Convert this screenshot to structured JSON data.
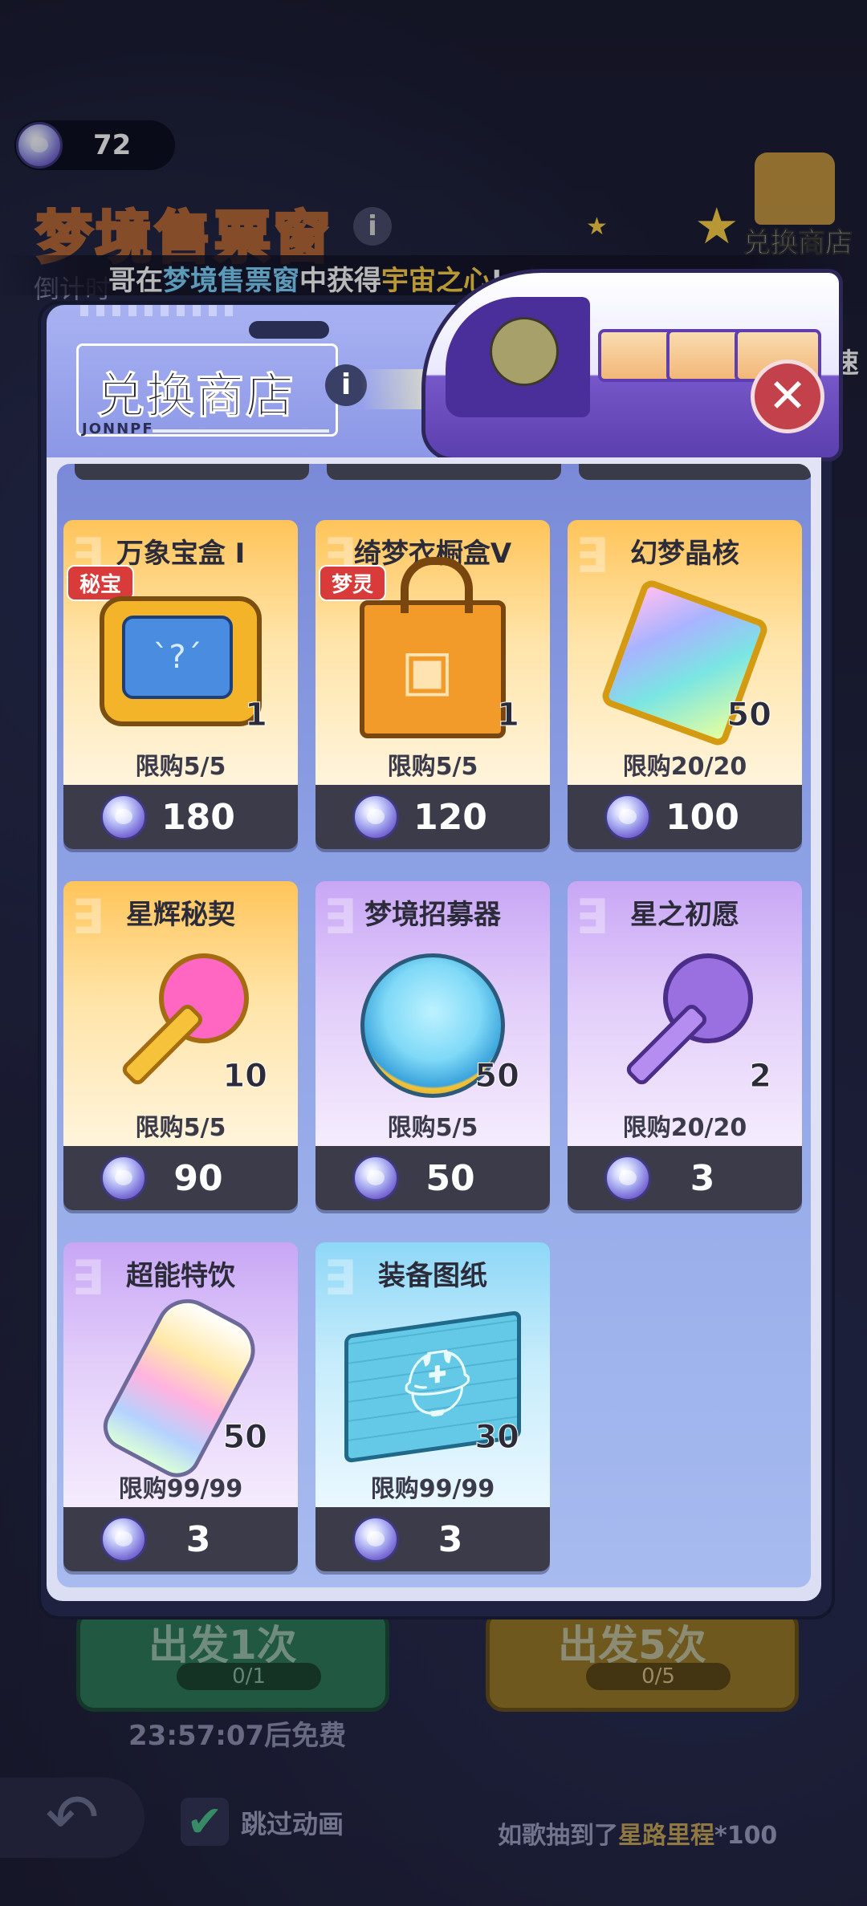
{
  "currency": {
    "amount": "72"
  },
  "background": {
    "title": "梦境售票窗",
    "timer_label": "倒计时",
    "shop_link": "兑换商店",
    "speed_label": "速",
    "ticker": {
      "prefix": "哥在",
      "place": "梦境售票窗",
      "middle": "中获得",
      "item": "宇宙之心",
      "suffix": "!"
    },
    "go_once": "出发1次",
    "go_five": "出发5次",
    "ticket_once": "0/1",
    "ticket_five": "0/5",
    "free_timer": "23:57:07后免费",
    "skip_label": "跳过动画",
    "bottom_ticker": {
      "prefix": "如歌抽到了",
      "item": "星路里程",
      "suffix": "*100"
    }
  },
  "modal": {
    "title": "兑换商店",
    "title_tag": "JONNPF",
    "info_icon": "info-icon",
    "close_icon": "close-icon",
    "items": [
      {
        "name": "万象宝盒 I",
        "badge": "秘宝",
        "qty": "1",
        "limit": "限购5/5",
        "price": "180",
        "style": "gold",
        "icon": "treasure-box-icon"
      },
      {
        "name": "绮梦衣橱盒V",
        "badge": "梦灵",
        "qty": "1",
        "limit": "限购5/5",
        "price": "120",
        "style": "gold",
        "icon": "wardrobe-bag-icon"
      },
      {
        "name": "幻梦晶核",
        "qty": "50",
        "limit": "限购20/20",
        "price": "100",
        "style": "gold",
        "icon": "crystal-core-icon"
      },
      {
        "name": "星辉秘契",
        "qty": "10",
        "limit": "限购5/5",
        "price": "90",
        "style": "gold",
        "icon": "star-key-icon"
      },
      {
        "name": "梦境招募器",
        "qty": "50",
        "limit": "限购5/5",
        "price": "50",
        "style": "purple",
        "icon": "recruiter-icon"
      },
      {
        "name": "星之初愿",
        "qty": "2",
        "limit": "限购20/20",
        "price": "3",
        "style": "purple",
        "icon": "purple-key-icon"
      },
      {
        "name": "超能特饮",
        "qty": "50",
        "limit": "限购99/99",
        "price": "3",
        "style": "purple",
        "icon": "energy-drink-icon"
      },
      {
        "name": "装备图纸",
        "qty": "30",
        "limit": "限购99/99",
        "price": "3",
        "style": "blue",
        "icon": "blueprint-icon"
      }
    ]
  },
  "colors": {
    "accent_gold": "#ffd34a",
    "accent_blue": "#7fd6ff",
    "close_red": "#c2414a"
  }
}
